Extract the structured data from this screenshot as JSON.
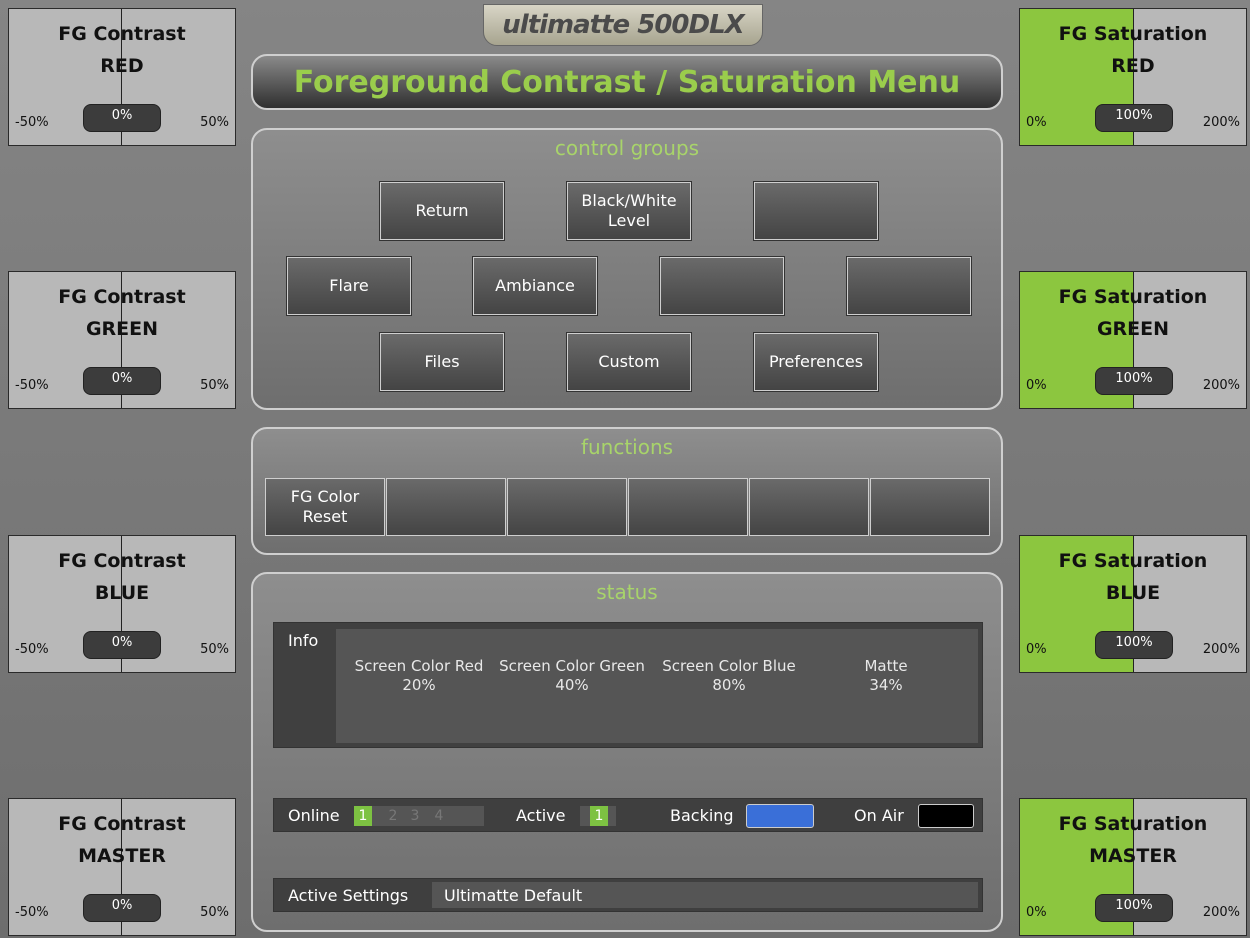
{
  "logo": "ultimatte 500DLX",
  "title": "Foreground Contrast / Saturation Menu",
  "left_knobs": [
    {
      "line1": "FG Contrast",
      "line2": "RED",
      "min": "-50%",
      "max": "50%",
      "value": "0%"
    },
    {
      "line1": "FG Contrast",
      "line2": "GREEN",
      "min": "-50%",
      "max": "50%",
      "value": "0%"
    },
    {
      "line1": "FG Contrast",
      "line2": "BLUE",
      "min": "-50%",
      "max": "50%",
      "value": "0%"
    },
    {
      "line1": "FG Contrast",
      "line2": "MASTER",
      "min": "-50%",
      "max": "50%",
      "value": "0%"
    }
  ],
  "right_knobs": [
    {
      "line1": "FG Saturation",
      "line2": "RED",
      "min": "0%",
      "max": "200%",
      "value": "100%"
    },
    {
      "line1": "FG Saturation",
      "line2": "GREEN",
      "min": "0%",
      "max": "200%",
      "value": "100%"
    },
    {
      "line1": "FG Saturation",
      "line2": "BLUE",
      "min": "0%",
      "max": "200%",
      "value": "100%"
    },
    {
      "line1": "FG Saturation",
      "line2": "MASTER",
      "min": "0%",
      "max": "200%",
      "value": "100%"
    }
  ],
  "control_groups": {
    "heading": "control groups",
    "buttons": {
      "return": "Return",
      "black_white": "Black/White Level",
      "flare": "Flare",
      "ambiance": "Ambiance",
      "files": "Files",
      "custom": "Custom",
      "preferences": "Preferences"
    }
  },
  "functions": {
    "heading": "functions",
    "fg_color_reset": "FG Color Reset"
  },
  "status": {
    "heading": "status",
    "info_label": "Info",
    "columns": [
      {
        "label": "Screen Color Red",
        "value": "20%"
      },
      {
        "label": "Screen Color Green",
        "value": "40%"
      },
      {
        "label": "Screen Color Blue",
        "value": "80%"
      },
      {
        "label": "Matte",
        "value": "34%"
      }
    ],
    "online_label": "Online",
    "online_numbers": [
      "1",
      "2",
      "3",
      "4"
    ],
    "active_label": "Active",
    "active_number": "1",
    "backing_label": "Backing",
    "backing_color": "#3a6fd8",
    "on_air_label": "On Air",
    "on_air_color": "#000000",
    "active_settings_label": "Active Settings",
    "active_settings_value": "Ultimatte Default"
  },
  "colors": {
    "accent_green": "#8cc63f",
    "heading_green": "#a8d46a"
  }
}
